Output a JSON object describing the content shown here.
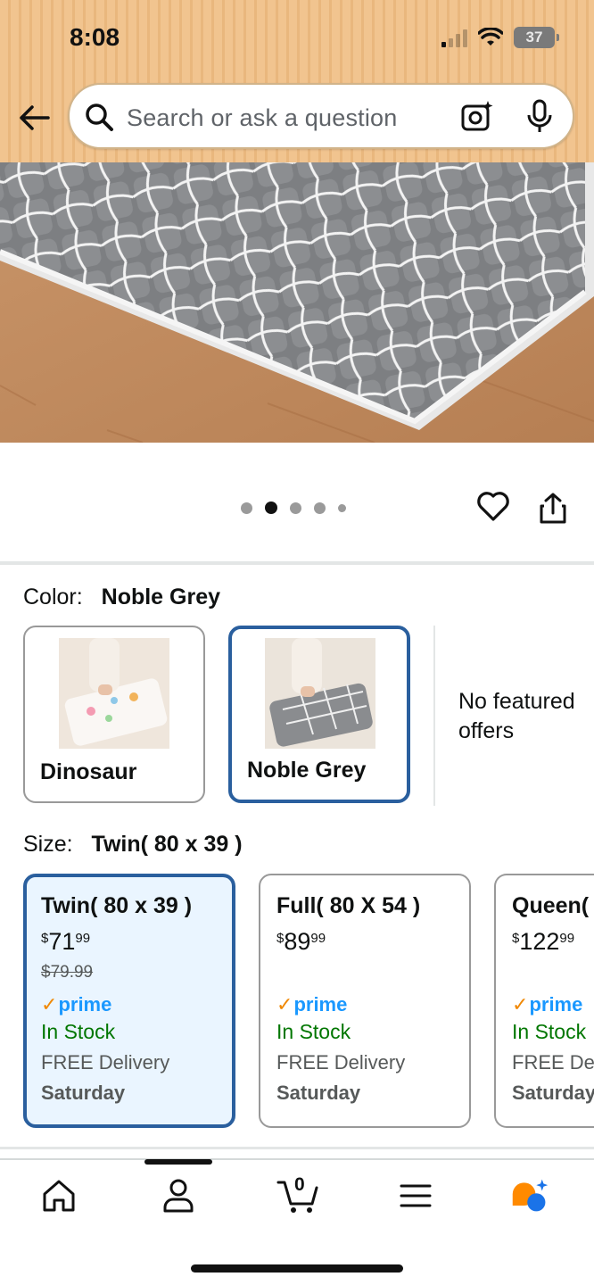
{
  "status_bar": {
    "time": "8:08",
    "battery": "37"
  },
  "search": {
    "placeholder": "Search or ask a question"
  },
  "gallery": {
    "dot_count": 5,
    "active_index": 1
  },
  "variations": {
    "color_label": "Color:",
    "color_selected": "Noble Grey",
    "colors": [
      {
        "name": "Dinosaur"
      },
      {
        "name": "Noble Grey"
      }
    ],
    "no_featured_offers": "No featured offers",
    "size_label": "Size:",
    "size_selected": "Twin( 80 x 39 )",
    "sizes": [
      {
        "title": "Twin( 80 x 39 )",
        "price_symbol": "$",
        "price_whole": "71",
        "price_cents": "99",
        "list_price": "$79.99",
        "prime": "prime",
        "stock": "In Stock",
        "delivery": "FREE Delivery",
        "delivery_day": "Saturday"
      },
      {
        "title": "Full( 80 X 54 )",
        "price_symbol": "$",
        "price_whole": "89",
        "price_cents": "99",
        "list_price": "",
        "prime": "prime",
        "stock": "In Stock",
        "delivery": "FREE Delivery",
        "delivery_day": "Saturday"
      },
      {
        "title": "Queen(",
        "price_symbol": "$",
        "price_whole": "122",
        "price_cents": "99",
        "list_price": "",
        "prime": "prime",
        "stock": "In Stock",
        "delivery": "FREE Del",
        "delivery_day": "Saturday"
      }
    ]
  },
  "tabbar": {
    "items": [
      "home-icon",
      "account-icon",
      "cart-icon",
      "menu-icon",
      "rufus-icon"
    ],
    "cart_count": "0"
  },
  "colors": {
    "accent_blue": "#2a5f9e",
    "prime_blue": "#1a98ff",
    "in_stock_green": "#007600",
    "header_bg": "#f1c48f"
  }
}
